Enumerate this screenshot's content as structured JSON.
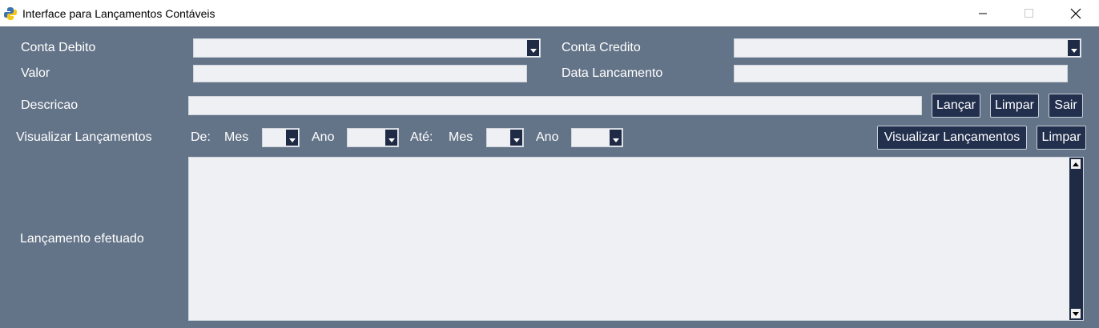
{
  "window": {
    "title": "Interface para Lançamentos Contáveis",
    "icon": "python-icon"
  },
  "form": {
    "conta_debito": {
      "label": "Conta Debito",
      "value": ""
    },
    "conta_credito": {
      "label": "Conta Credito",
      "value": ""
    },
    "valor": {
      "label": "Valor",
      "value": ""
    },
    "data_lancamento": {
      "label": "Data Lancamento",
      "value": ""
    },
    "descricao": {
      "label": "Descricao",
      "value": ""
    }
  },
  "buttons": {
    "lancar": "Lançar",
    "limpar": "Limpar",
    "sair": "Sair",
    "visualizar": "Visualizar Lançamentos",
    "limpar_view": "Limpar"
  },
  "filter": {
    "label": "Visualizar Lançamentos",
    "de": "De:",
    "mes_1": "Mes",
    "ano_1": "Ano",
    "ate": "Até:",
    "mes_2": "Mes",
    "ano_2": "Ano"
  },
  "output": {
    "label": "Lançamento efetuado",
    "content": ""
  },
  "colors": {
    "background": "#647488",
    "button": "#22304e",
    "field": "#eef0f4"
  }
}
